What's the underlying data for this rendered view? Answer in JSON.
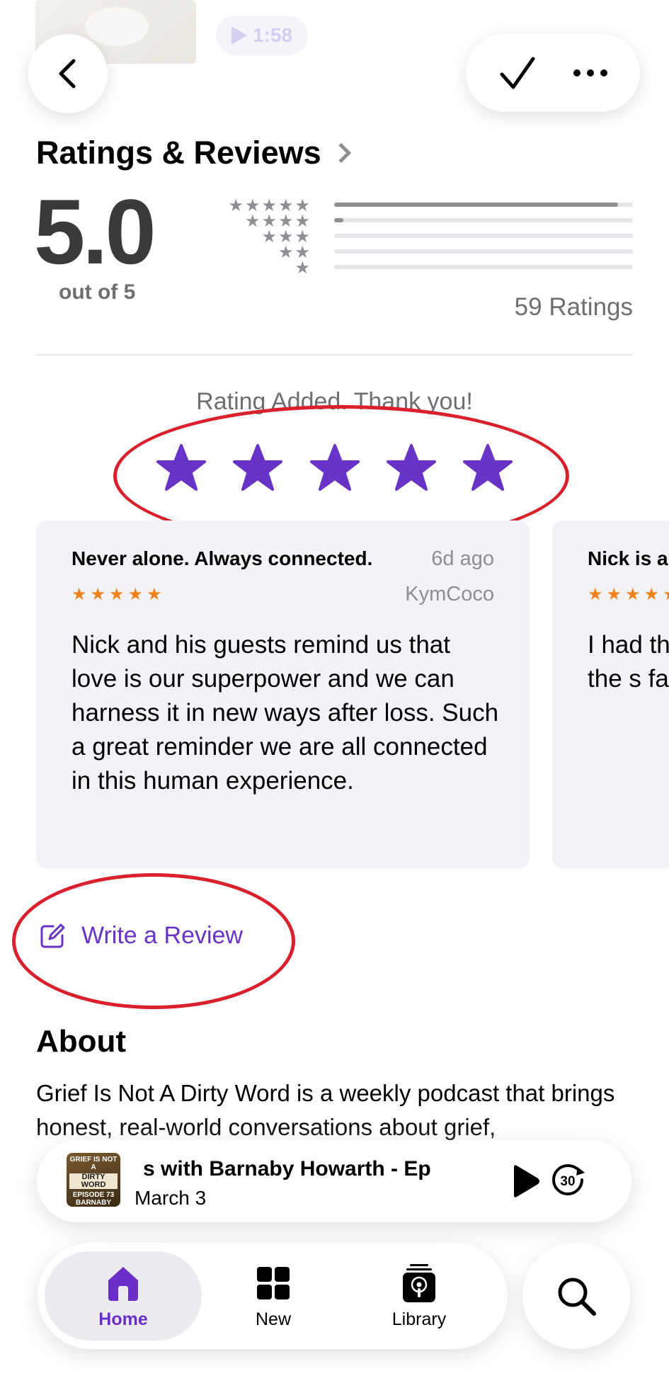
{
  "top": {
    "duration": "1:58"
  },
  "ratings": {
    "title": "Ratings & Reviews",
    "score": "5.0",
    "out_of": "out of 5",
    "count_label": "59 Ratings",
    "distribution": [
      {
        "stars": 5,
        "fraction": 0.95
      },
      {
        "stars": 4,
        "fraction": 0.03
      },
      {
        "stars": 3,
        "fraction": 0.0
      },
      {
        "stars": 2,
        "fraction": 0.0
      },
      {
        "stars": 1,
        "fraction": 0.0
      }
    ]
  },
  "tap_to_rate": {
    "message": "Rating Added. Thank you!",
    "selected": 5,
    "star_color": "#6833c7"
  },
  "reviews": [
    {
      "title": "Never alone. Always connected.",
      "date": "6d ago",
      "author": "KymCoco",
      "stars": "★★★★★",
      "body": "Nick and his guests remind us that love is our superpower and we can harness it in new ways after loss. Such a great reminder we are all connected in this human experience."
    },
    {
      "title": "Nick is a",
      "stars": "★★★★★",
      "body": "I had th podcas dive int of the s father a my fath"
    }
  ],
  "write_review": {
    "label": "Write a Review"
  },
  "about": {
    "title": "About",
    "text": "Grief Is Not A Dirty Word is a weekly podcast that brings honest, real-world conversations about grief,"
  },
  "mini_player": {
    "art_line1": "GRIEF IS NOT A",
    "art_line2": "DIRTY WORD",
    "art_line3": "EPISODE 73",
    "art_line4": "BARNABY HOWARTH",
    "title": "s with Barnaby Howarth - Ep",
    "date": "March 3",
    "skip_seconds": "30"
  },
  "tabs": {
    "home": "Home",
    "new": "New",
    "library": "Library"
  },
  "colors": {
    "accent": "#6833c7",
    "review_stars": "#f0821e",
    "annotation": "#d9202c"
  }
}
